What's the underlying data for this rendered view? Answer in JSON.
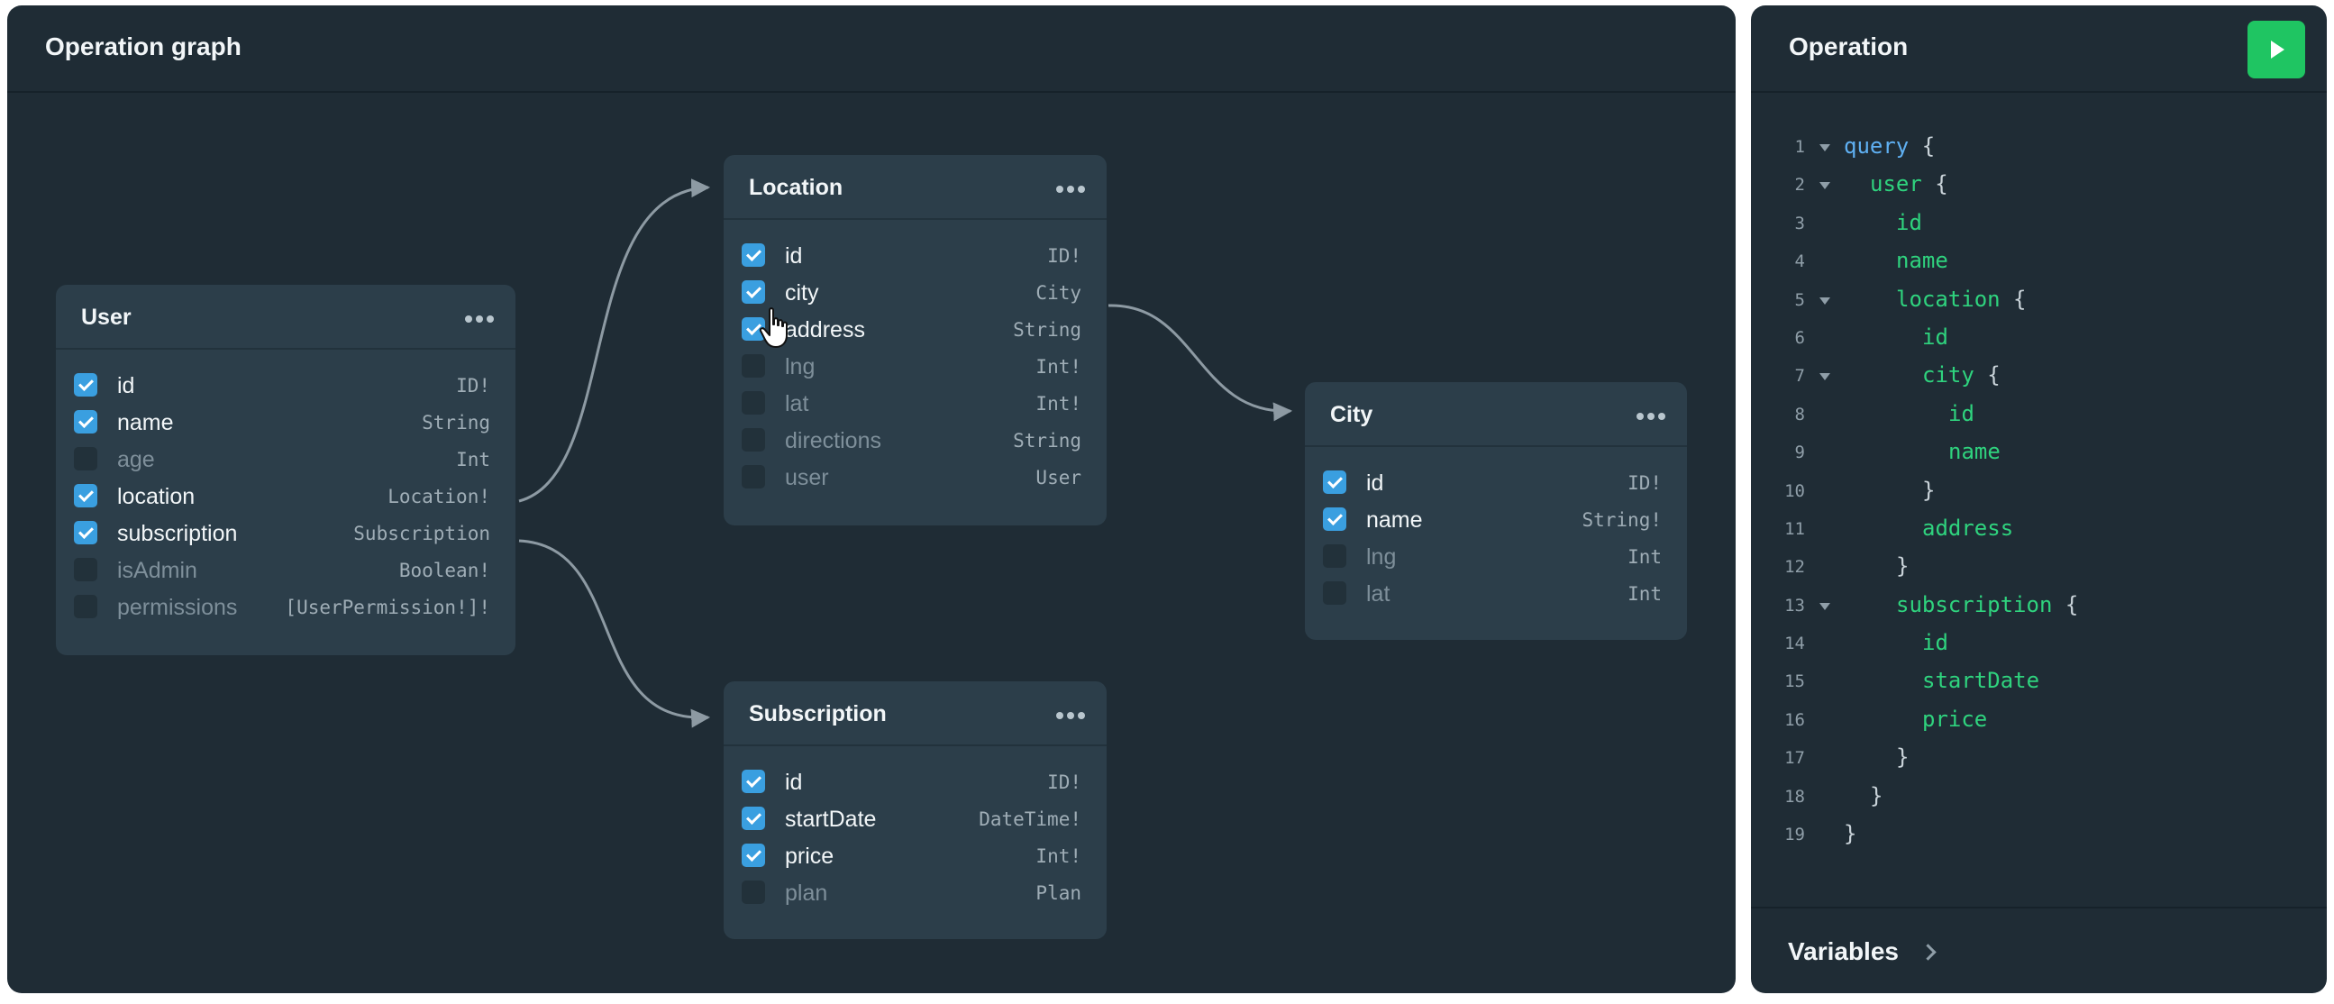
{
  "graph": {
    "title": "Operation graph"
  },
  "nodes": {
    "user": {
      "title": "User",
      "fields": [
        {
          "name": "id",
          "type": "ID!",
          "checked": true
        },
        {
          "name": "name",
          "type": "String",
          "checked": true
        },
        {
          "name": "age",
          "type": "Int",
          "checked": false
        },
        {
          "name": "location",
          "type": "Location!",
          "checked": true
        },
        {
          "name": "subscription",
          "type": "Subscription",
          "checked": true
        },
        {
          "name": "isAdmin",
          "type": "Boolean!",
          "checked": false
        },
        {
          "name": "permissions",
          "type": "[UserPermission!]!",
          "checked": false
        }
      ]
    },
    "location": {
      "title": "Location",
      "fields": [
        {
          "name": "id",
          "type": "ID!",
          "checked": true
        },
        {
          "name": "city",
          "type": "City",
          "checked": true
        },
        {
          "name": "address",
          "type": "String",
          "checked": true
        },
        {
          "name": "lng",
          "type": "Int!",
          "checked": false
        },
        {
          "name": "lat",
          "type": "Int!",
          "checked": false
        },
        {
          "name": "directions",
          "type": "String",
          "checked": false
        },
        {
          "name": "user",
          "type": "User",
          "checked": false
        }
      ]
    },
    "city": {
      "title": "City",
      "fields": [
        {
          "name": "id",
          "type": "ID!",
          "checked": true
        },
        {
          "name": "name",
          "type": "String!",
          "checked": true
        },
        {
          "name": "lng",
          "type": "Int",
          "checked": false
        },
        {
          "name": "lat",
          "type": "Int",
          "checked": false
        }
      ]
    },
    "subscription": {
      "title": "Subscription",
      "fields": [
        {
          "name": "id",
          "type": "ID!",
          "checked": true
        },
        {
          "name": "startDate",
          "type": "DateTime!",
          "checked": true
        },
        {
          "name": "price",
          "type": "Int!",
          "checked": true
        },
        {
          "name": "plan",
          "type": "Plan",
          "checked": false
        }
      ]
    }
  },
  "operation": {
    "title": "Operation",
    "lines": [
      {
        "num": "1",
        "indent": 0,
        "fold": true,
        "tokens": [
          [
            "kw",
            "query"
          ],
          [
            "punct",
            " {"
          ]
        ]
      },
      {
        "num": "2",
        "indent": 1,
        "fold": true,
        "tokens": [
          [
            "fld",
            "user"
          ],
          [
            "punct",
            " {"
          ]
        ]
      },
      {
        "num": "3",
        "indent": 2,
        "fold": false,
        "tokens": [
          [
            "fld",
            "id"
          ]
        ]
      },
      {
        "num": "4",
        "indent": 2,
        "fold": false,
        "tokens": [
          [
            "fld",
            "name"
          ]
        ]
      },
      {
        "num": "5",
        "indent": 2,
        "fold": true,
        "tokens": [
          [
            "fld",
            "location"
          ],
          [
            "punct",
            " {"
          ]
        ]
      },
      {
        "num": "6",
        "indent": 3,
        "fold": false,
        "tokens": [
          [
            "fld",
            "id"
          ]
        ]
      },
      {
        "num": "7",
        "indent": 3,
        "fold": true,
        "tokens": [
          [
            "fld",
            "city"
          ],
          [
            "punct",
            " {"
          ]
        ]
      },
      {
        "num": "8",
        "indent": 4,
        "fold": false,
        "tokens": [
          [
            "fld",
            "id"
          ]
        ]
      },
      {
        "num": "9",
        "indent": 4,
        "fold": false,
        "tokens": [
          [
            "fld",
            "name"
          ]
        ]
      },
      {
        "num": "10",
        "indent": 3,
        "fold": false,
        "tokens": [
          [
            "punct",
            "}"
          ]
        ]
      },
      {
        "num": "11",
        "indent": 3,
        "fold": false,
        "tokens": [
          [
            "fld",
            "address"
          ]
        ]
      },
      {
        "num": "12",
        "indent": 2,
        "fold": false,
        "tokens": [
          [
            "punct",
            "}"
          ]
        ]
      },
      {
        "num": "13",
        "indent": 2,
        "fold": true,
        "tokens": [
          [
            "fld",
            "subscription"
          ],
          [
            "punct",
            " {"
          ]
        ]
      },
      {
        "num": "14",
        "indent": 3,
        "fold": false,
        "tokens": [
          [
            "fld",
            "id"
          ]
        ]
      },
      {
        "num": "15",
        "indent": 3,
        "fold": false,
        "tokens": [
          [
            "fld",
            "startDate"
          ]
        ]
      },
      {
        "num": "16",
        "indent": 3,
        "fold": false,
        "tokens": [
          [
            "fld",
            "price"
          ]
        ]
      },
      {
        "num": "17",
        "indent": 2,
        "fold": false,
        "tokens": [
          [
            "punct",
            "}"
          ]
        ]
      },
      {
        "num": "18",
        "indent": 1,
        "fold": false,
        "tokens": [
          [
            "punct",
            "}"
          ]
        ]
      },
      {
        "num": "19",
        "indent": 0,
        "fold": false,
        "tokens": [
          [
            "punct",
            "}"
          ]
        ]
      }
    ]
  },
  "variables": {
    "label": "Variables"
  },
  "icons": {
    "run": "play-icon",
    "menu": "more-horizontal-icon",
    "chevron": "chevron-right-icon",
    "cursor": "hand-pointer-icon"
  },
  "colors": {
    "panel": "#1f2c35",
    "node": "#2c3e4a",
    "checked": "#3a9fe0",
    "run": "#1fc562",
    "keyword": "#5fb0f2",
    "field": "#2fd37e"
  }
}
